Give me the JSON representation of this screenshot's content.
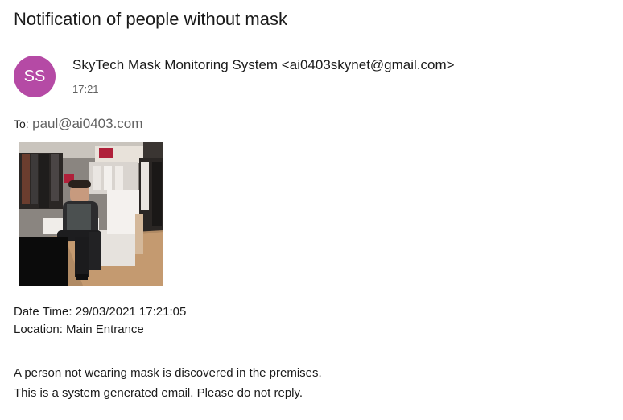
{
  "email": {
    "subject": "Notification of people without mask",
    "sender_initials": "SS",
    "sender": "SkyTech Mask Monitoring System <ai0403skynet@gmail.com>",
    "time": "17:21",
    "to_label": "To:",
    "to_value": "paul@ai0403.com",
    "attachment_image": "store-camera-photo",
    "datetime_line": "Date Time: 29/03/2021 17:21:05",
    "location_line": "Location: Main Entrance",
    "body_line_1": "A person not wearing mask is discovered in the premises.",
    "body_line_2": "This is a system generated email. Please do not reply."
  },
  "colors": {
    "avatar_bg": "#b54aa5"
  }
}
